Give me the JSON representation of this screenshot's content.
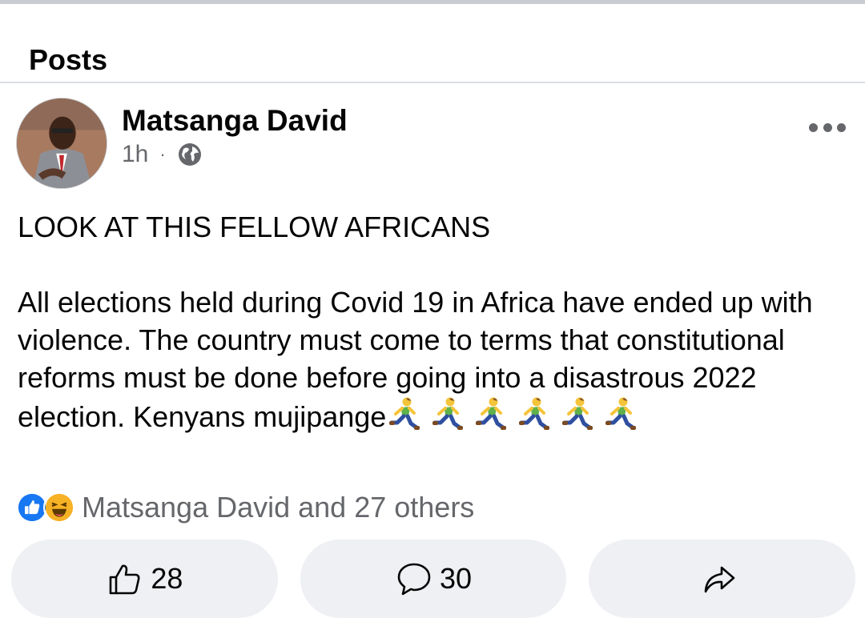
{
  "section": {
    "title": "Posts"
  },
  "post": {
    "author": "Matsanga David",
    "time": "1h",
    "separator": "·",
    "privacy_icon": "globe-icon",
    "more_icon": "more-options-icon",
    "headline": "LOOK AT THIS FELLOW AFRICANS",
    "body": "All elections held during Covid 19 in Africa have ended up with  violence. The country must come to terms that constitutional reforms must be done before going into a disastrous 2022 election. Kenyans mujipange",
    "emoji": {
      "name": "person-running-icon",
      "count": 6
    }
  },
  "reactions": {
    "icons": [
      "like-icon",
      "haha-icon"
    ],
    "summary": "Matsanga David and 27 others"
  },
  "actions": {
    "like": {
      "icon": "thumbs-up-icon",
      "count": "28"
    },
    "comment": {
      "icon": "comment-icon",
      "count": "30"
    },
    "share": {
      "icon": "share-icon"
    }
  },
  "colors": {
    "text_primary": "#050505",
    "text_secondary": "#65676b",
    "button_bg": "#eff0f3",
    "divider": "#dadde1",
    "like_blue": "#1877f2",
    "haha_yellow": "#f7b125"
  }
}
